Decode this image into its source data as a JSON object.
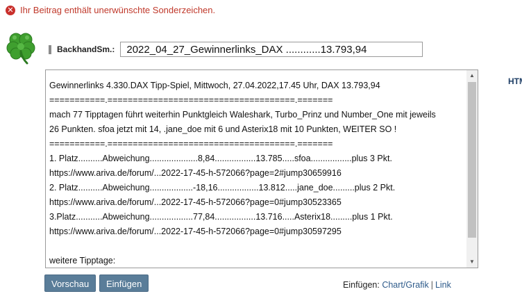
{
  "error": {
    "icon": "error-x-icon",
    "icon_glyph": "✕",
    "message": "Ihr Beitrag enthält unerwünschte Sonderzeichen."
  },
  "author": {
    "avatar_icon": "four-leaf-clover-icon",
    "username": "BackhandSm.:"
  },
  "subject": {
    "value": "2022_04_27_Gewinnerlinks_DAX ............13.793,94"
  },
  "editor": {
    "lines": [
      "Gewinnerlinks 4.330.DAX Tipp-Spiel, Mittwoch, 27.04.2022,17.45 Uhr, DAX 13.793,94",
      "===========.=====================================.=======",
      "mach 77 Tipptagen führt weiterhin Punktgleich  Waleshark, Turbo_Prinz und Number_One mit jeweils",
      "26 Punkten.  sfoa jetzt mit 14, .jane_doe mit 6 und Asterix18 mit 10 Punkten, WEITER SO !",
      "===========.=====================================.=======",
      "1. Platz..........Abweichung....................8,84.................13.785.....sfoa.................plus 3 Pkt.",
      "https://www.ariva.de/forum/...2022-17-45-h-572066?page=2#jump30659916",
      "2. Platz..........Abweichung..................-18,16.................13.812.....jane_doe.........plus 2 Pkt.",
      "https://www.ariva.de/forum/...2022-17-45-h-572066?page=0#jump30523365",
      "3.Platz...........Abweichung..................77,84.................13.716.....Asterix18.........plus 1 Pkt.",
      "https://www.ariva.de/forum/...2022-17-45-h-572066?page=0#jump30597295",
      "",
      "weitere Tipptage:"
    ]
  },
  "html_editor_link": "HTML-Ed",
  "buttons": {
    "preview": "Vorschau",
    "insert": "Einfügen"
  },
  "insert": {
    "label": "Einfügen:",
    "chart": "Chart/Grafik",
    "separator": "|",
    "link": "Link"
  },
  "colors": {
    "error": "#c0392b",
    "button": "#5a7d99",
    "link": "#2d5a8a",
    "clover": "#3f9f2f"
  }
}
